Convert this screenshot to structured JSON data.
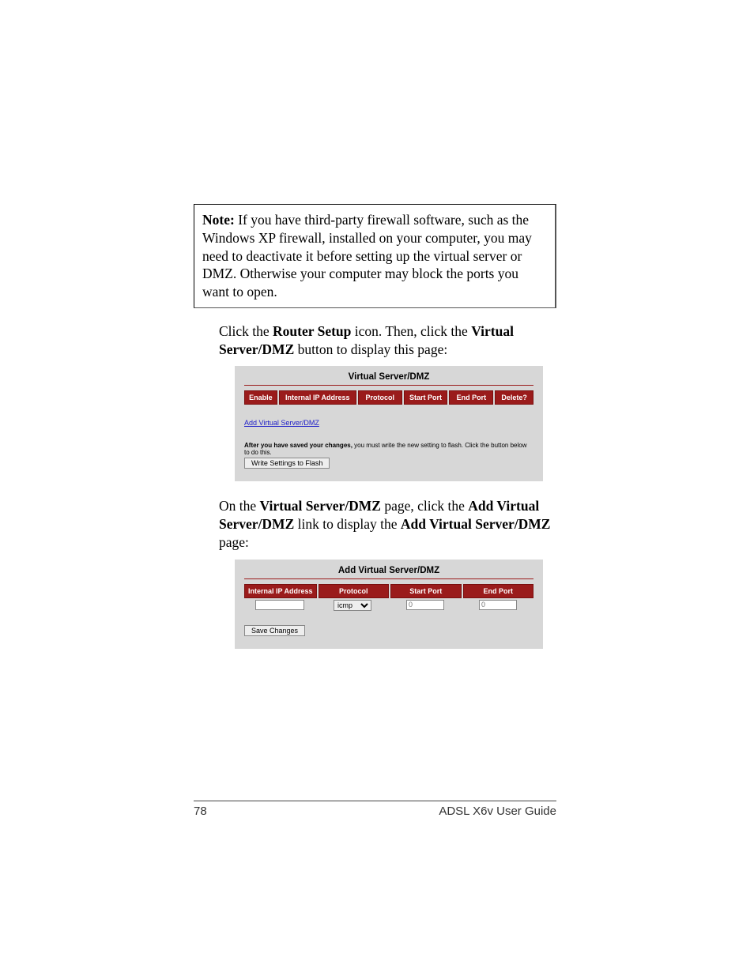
{
  "note": {
    "label": "Note:",
    "text": " If you have third-party firewall software, such as the Windows XP firewall, installed on your computer, you may need to deactivate it before setting up the virtual server or DMZ. Otherwise your computer may block the ports you want to open."
  },
  "para1": {
    "t1": "Click the ",
    "b1": "Router Setup",
    "t2": " icon. Then, click the ",
    "b2": "Virtual Server/DMZ",
    "t3": " button to display this page:"
  },
  "panel1": {
    "title": "Virtual Server/DMZ",
    "headers": [
      "Enable",
      "Internal IP Address",
      "Protocol",
      "Start Port",
      "End Port",
      "Delete?"
    ],
    "link": "Add Virtual Server/DMZ",
    "hint_bold": "After you have saved your changes,",
    "hint_rest": " you must write the new setting to flash. Click the button below to do this.",
    "write_btn": "Write Settings to Flash"
  },
  "para2": {
    "t1": "On the ",
    "b1": "Virtual Server/DMZ",
    "t2": " page, click the ",
    "b2": "Add Virtual Server/DMZ",
    "t3": " link to display the ",
    "b3": "Add Virtual Server/DMZ",
    "t4": " page:"
  },
  "panel2": {
    "title": "Add Virtual Server/DMZ",
    "headers": [
      "Internal IP Address",
      "Protocol",
      "Start Port",
      "End Port"
    ],
    "protocol_value": "icmp",
    "start_port_placeholder": "0",
    "end_port_placeholder": "0",
    "save_btn": "Save Changes"
  },
  "footer": {
    "page": "78",
    "title": "ADSL X6v User Guide"
  }
}
